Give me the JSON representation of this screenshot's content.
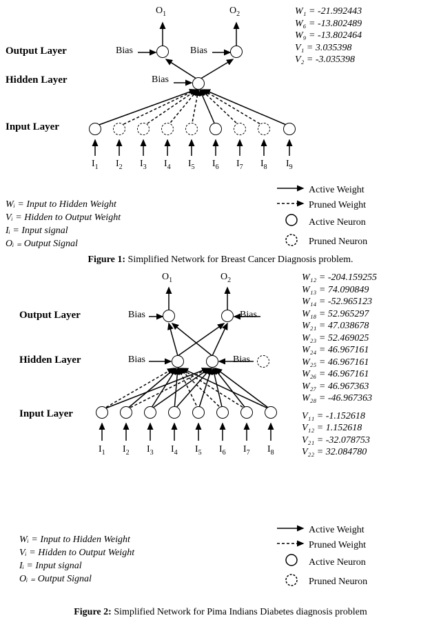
{
  "figure1": {
    "outputs": [
      "O",
      "O"
    ],
    "output_subs": [
      "1",
      "2"
    ],
    "layers": {
      "output": "Output Layer",
      "hidden": "Hidden Layer",
      "input": "Input Layer"
    },
    "bias": "Bias",
    "inputs": [
      "I",
      "I",
      "I",
      "I",
      "I",
      "I",
      "I",
      "I",
      "I"
    ],
    "input_subs": [
      "1",
      "2",
      "3",
      "4",
      "5",
      "6",
      "7",
      "8",
      "9"
    ],
    "weights": [
      "W₁ =  -21.992443",
      "W₆ =  -13.802489",
      "W₉ = -13.802464",
      "V₁ = 3.035398",
      "V₂ = -3.035398"
    ],
    "notation": [
      "Wᵢ = Input to Hidden Weight",
      "Vᵢ = Hidden to Output Weight",
      "Iᵢ = Input signal",
      "Oᵢ ₌ Output Signal"
    ],
    "legend": {
      "active_weight": "Active Weight",
      "pruned_weight": "Pruned Weight",
      "active_neuron": "Active Neuron",
      "pruned_neuron": "Pruned Neuron"
    },
    "caption_bold": "Figure 1:",
    "caption_text": " Simplified Network for Breast Cancer Diagnosis problem."
  },
  "figure2": {
    "outputs": [
      "O",
      "O"
    ],
    "output_subs": [
      "1",
      "2"
    ],
    "layers": {
      "output": "Output Layer",
      "hidden": "Hidden Layer",
      "input": "Input Layer"
    },
    "bias": "Bias",
    "inputs": [
      "I",
      "I",
      "I",
      "I",
      "I",
      "I",
      "I",
      "I"
    ],
    "input_subs": [
      "1",
      "2",
      "3",
      "4",
      "5",
      "6",
      "7",
      "8"
    ],
    "weights": [
      "W₁₂ =  -204.159255",
      "W₁₃ = 74.090849",
      "W₁₄ = -52.965123",
      "W₁₈ = 52.965297",
      "W₂₁ = 47.038678",
      "W₂₃ = 52.469025",
      "W₂₄ = 46.967161",
      "W₂₅ = 46.967161",
      "W₂₆ = 46.967161",
      "W₂₇ = 46.967363",
      "W₂₈ = -46.967363",
      "",
      "V₁₁ = -1.152618",
      "V₁₂ = 1.152618",
      "V₂₁ = -32.078753",
      "V₂₂ = 32.084780"
    ],
    "notation": [
      "Wᵢ = Input to Hidden Weight",
      "Vᵢ = Hidden to Output Weight",
      "Iᵢ = Input signal",
      "Oᵢ ₌ Output Signal"
    ],
    "legend": {
      "active_weight": "Active Weight",
      "pruned_weight": "Pruned Weight",
      "active_neuron": "Active Neuron",
      "pruned_neuron": "Pruned Neuron"
    },
    "caption_bold": "Figure 2:",
    "caption_text": " Simplified Network for Pima Indians Diabetes diagnosis problem"
  },
  "chart_data": [
    {
      "type": "diagram",
      "title": "Simplified Network for Breast Cancer Diagnosis problem",
      "layers": {
        "input": {
          "count": 9,
          "active": [
            1,
            6,
            9
          ],
          "pruned": [
            2,
            3,
            4,
            5,
            7,
            8
          ]
        },
        "hidden": {
          "count": 1,
          "active": [
            1
          ],
          "pruned": []
        },
        "output": {
          "count": 2,
          "active": [
            1,
            2
          ],
          "pruned": []
        }
      },
      "weights": {
        "W1": -21.992443,
        "W6": -13.802489,
        "W9": -13.802464,
        "V1": 3.035398,
        "V2": -3.035398
      }
    },
    {
      "type": "diagram",
      "title": "Simplified Network for Pima Indians Diabetes diagnosis problem",
      "layers": {
        "input": {
          "count": 8,
          "active": [
            1,
            2,
            3,
            4,
            5,
            6,
            7,
            8
          ],
          "pruned": []
        },
        "hidden": {
          "count": 3,
          "active": [
            1,
            2
          ],
          "pruned": [
            3
          ]
        },
        "output": {
          "count": 2,
          "active": [
            1,
            2
          ],
          "pruned": []
        }
      },
      "weights": {
        "W12": -204.159255,
        "W13": 74.090849,
        "W14": -52.965123,
        "W18": 52.965297,
        "W21": 47.038678,
        "W23": 52.469025,
        "W24": 46.967161,
        "W25": 46.967161,
        "W26": 46.967161,
        "W27": 46.967363,
        "W28": -46.967363,
        "V11": -1.152618,
        "V12": 1.152618,
        "V21": -32.078753,
        "V22": 32.08478
      }
    }
  ]
}
